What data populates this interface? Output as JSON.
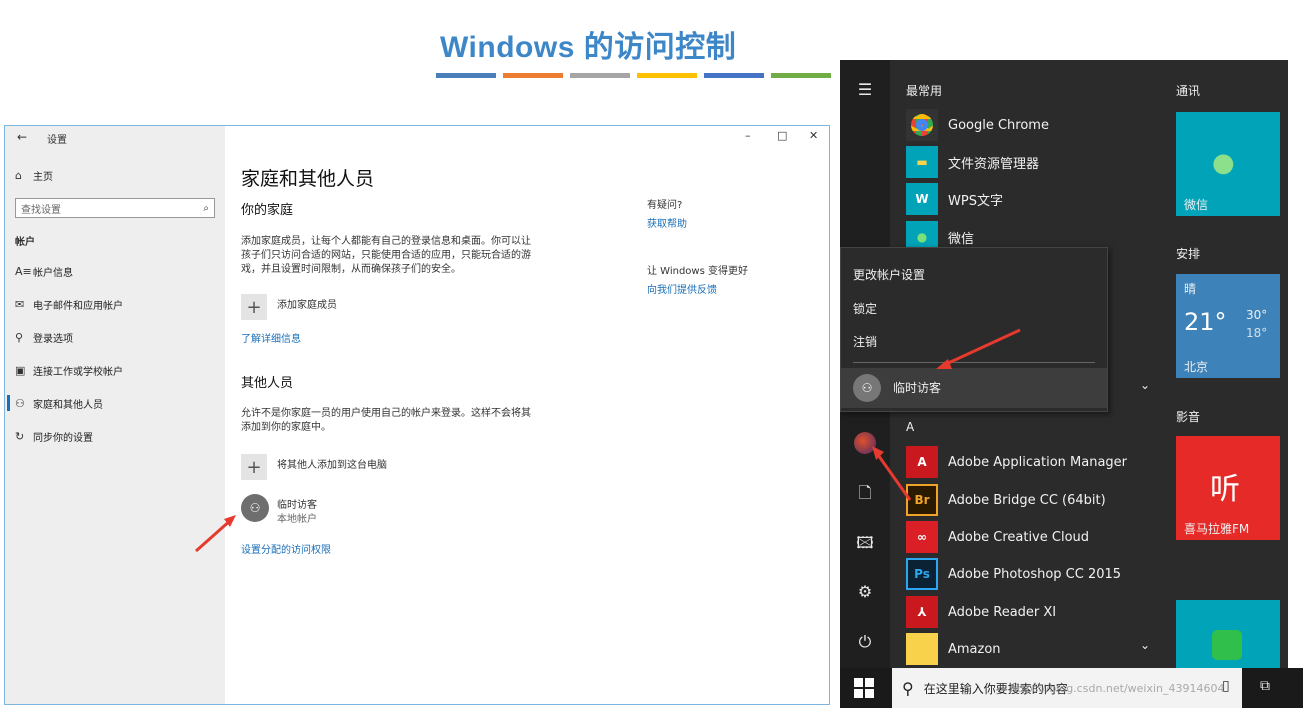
{
  "slide": {
    "title": "Windows 的访问控制",
    "bar_colors": [
      "#4a7ebb",
      "#ed7d31",
      "#a5a5a5",
      "#ffc000",
      "#4472c4",
      "#70ad47"
    ]
  },
  "settings": {
    "window_title": "设置",
    "controls": {
      "minimize": "–",
      "maximize": "□",
      "close": "✕"
    },
    "sidebar": {
      "home": "主页",
      "search_placeholder": "查找设置",
      "section": "帐户",
      "items": [
        "帐户信息",
        "电子邮件和应用帐户",
        "登录选项",
        "连接工作或学校帐户",
        "家庭和其他人员",
        "同步你的设置"
      ]
    },
    "main": {
      "heading": "家庭和其他人员",
      "family_title": "你的家庭",
      "family_desc_1": "添加家庭成员，让每个人都能有自己的登录信息和桌面。你可以让",
      "family_desc_2": "孩子们只访问合适的网站，只能使用合适的应用，只能玩合适的游",
      "family_desc_3": "戏，并且设置时间限制，从而确保孩子们的安全。",
      "add_family": "添加家庭成员",
      "learn_more": "了解详细信息",
      "others_title": "其他人员",
      "others_desc_1": "允许不是你家庭一员的用户使用自己的帐户来登录。这样不会将其",
      "others_desc_2": "添加到你的家庭中。",
      "add_other": "将其他人添加到这台电脑",
      "user_name": "临时访客",
      "user_type": "本地帐户",
      "assigned_access": "设置分配的访问权限",
      "help_q": "有疑问?",
      "help_link": "获取帮助",
      "improve": "让 Windows 变得更好",
      "feedback": "向我们提供反馈"
    }
  },
  "start_menu": {
    "most_used": "最常用",
    "apps_top": [
      "Google Chrome",
      "文件资源管理器",
      "WPS文字",
      "微信"
    ],
    "context": [
      "更改帐户设置",
      "锁定",
      "注销"
    ],
    "context_user": "临时访客",
    "letter": "A",
    "apps_a": [
      "Adobe Application Manager",
      "Adobe Bridge CC (64bit)",
      "Adobe Creative Cloud",
      "Adobe Photoshop CC 2015",
      "Adobe Reader XI",
      "Amazon"
    ],
    "groups": {
      "comm": "通讯",
      "arrange": "安排",
      "media": "影音"
    },
    "tiles": {
      "wechat": "微信",
      "weather_cond": "晴",
      "weather_temp": "21°",
      "weather_hi": "30°",
      "weather_lo": "18°",
      "weather_city": "北京",
      "ximalaya": "喜马拉雅FM",
      "ximalaya_logo": "听"
    },
    "search_placeholder": "在这里输入你要搜索的内容",
    "watermark": "https://blog.csdn.net/weixin_43914604"
  }
}
